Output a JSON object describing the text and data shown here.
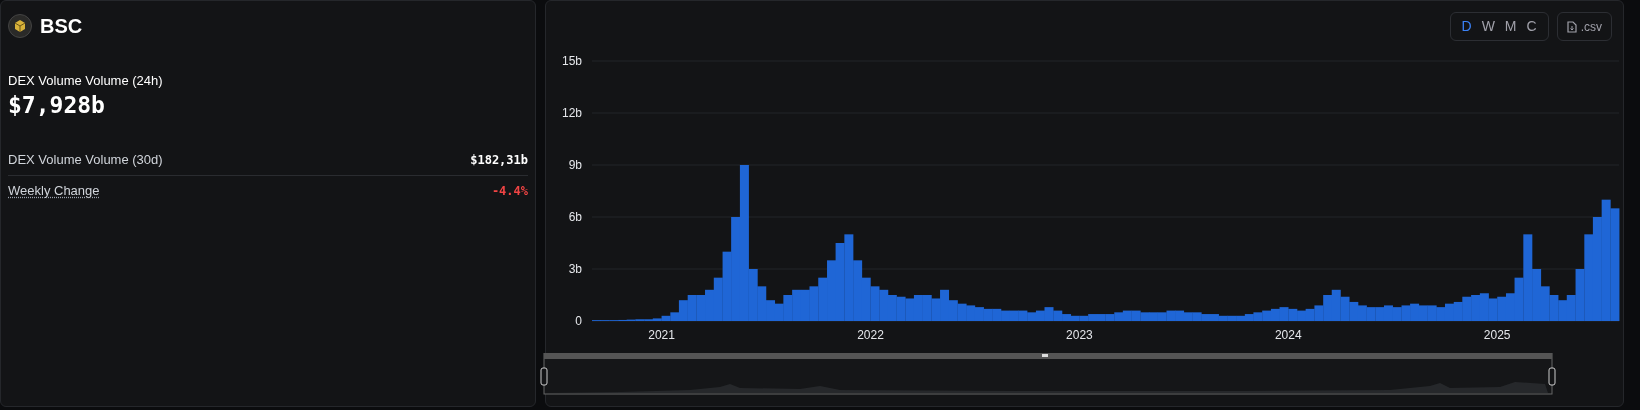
{
  "summary": {
    "chain": "BSC",
    "main_label": "DEX Volume Volume (24h)",
    "main_value": "$7,928b",
    "stats": [
      {
        "label": "DEX Volume Volume (30d)",
        "value": "$182,31b",
        "kind": "plain"
      },
      {
        "label": "Weekly Change",
        "value": "-4.4%",
        "kind": "change"
      }
    ]
  },
  "chart_panel": {
    "periods": [
      {
        "label": "D",
        "selected": true
      },
      {
        "label": "W",
        "selected": false
      },
      {
        "label": "M",
        "selected": false
      },
      {
        "label": "C",
        "selected": false
      }
    ],
    "csv_button": ".csv",
    "range_slider": {
      "level": 1
    },
    "chart_data": {
      "type": "bar",
      "grid": true,
      "ylim": [
        0,
        15
      ],
      "xlim": [
        2020.667,
        2025.583
      ],
      "yticks": [
        {
          "value": 0,
          "label": "0"
        },
        {
          "value": 3,
          "label": "3b"
        },
        {
          "value": 6,
          "label": "6b"
        },
        {
          "value": 9,
          "label": "9b"
        },
        {
          "value": 12,
          "label": "12b"
        },
        {
          "value": 15,
          "label": "15b"
        }
      ],
      "xticks": [
        {
          "value": 2021,
          "label": "2021"
        },
        {
          "value": 2022,
          "label": "2022"
        },
        {
          "value": 2023,
          "label": "2023"
        },
        {
          "value": 2024,
          "label": "2024"
        },
        {
          "value": 2025,
          "label": "2025"
        }
      ],
      "x": [
        2020.667,
        2020.708,
        2020.75,
        2020.792,
        2020.833,
        2020.875,
        2020.917,
        2020.958,
        2021,
        2021.042,
        2021.083,
        2021.125,
        2021.167,
        2021.208,
        2021.25,
        2021.292,
        2021.333,
        2021.375,
        2021.417,
        2021.458,
        2021.5,
        2021.542,
        2021.583,
        2021.625,
        2021.667,
        2021.708,
        2021.75,
        2021.792,
        2021.833,
        2021.875,
        2021.917,
        2021.958,
        2022,
        2022.042,
        2022.083,
        2022.125,
        2022.167,
        2022.208,
        2022.25,
        2022.292,
        2022.333,
        2022.375,
        2022.417,
        2022.458,
        2022.5,
        2022.542,
        2022.583,
        2022.625,
        2022.667,
        2022.708,
        2022.75,
        2022.792,
        2022.833,
        2022.875,
        2022.917,
        2022.958,
        2023,
        2023.042,
        2023.083,
        2023.125,
        2023.167,
        2023.208,
        2023.25,
        2023.292,
        2023.333,
        2023.375,
        2023.417,
        2023.458,
        2023.5,
        2023.542,
        2023.583,
        2023.625,
        2023.667,
        2023.708,
        2023.75,
        2023.792,
        2023.833,
        2023.875,
        2023.917,
        2023.958,
        2024,
        2024.042,
        2024.083,
        2024.125,
        2024.167,
        2024.208,
        2024.25,
        2024.292,
        2024.333,
        2024.375,
        2024.417,
        2024.458,
        2024.5,
        2024.542,
        2024.583,
        2024.625,
        2024.667,
        2024.708,
        2024.75,
        2024.792,
        2024.833,
        2024.875,
        2024.917,
        2024.958,
        2025,
        2025.042,
        2025.083,
        2025.125,
        2025.167,
        2025.208,
        2025.25,
        2025.292,
        2025.333,
        2025.375,
        2025.417,
        2025.458,
        2025.5,
        2025.542
      ],
      "series": [
        {
          "color": "#1f66d6",
          "values": [
            0.05,
            0.05,
            0.05,
            0.06,
            0.08,
            0.1,
            0.1,
            0.15,
            0.3,
            0.5,
            1.2,
            1.5,
            1.5,
            1.8,
            2.5,
            4,
            6,
            9,
            3,
            2,
            1.2,
            1,
            1.5,
            1.8,
            1.8,
            2,
            2.5,
            3.5,
            4.5,
            5,
            3.5,
            2.5,
            2,
            1.8,
            1.5,
            1.4,
            1.3,
            1.5,
            1.5,
            1.3,
            1.8,
            1.2,
            1,
            0.9,
            0.8,
            0.7,
            0.7,
            0.6,
            0.6,
            0.6,
            0.5,
            0.6,
            0.8,
            0.6,
            0.4,
            0.3,
            0.3,
            0.4,
            0.4,
            0.4,
            0.5,
            0.6,
            0.6,
            0.5,
            0.5,
            0.5,
            0.6,
            0.6,
            0.5,
            0.5,
            0.4,
            0.4,
            0.3,
            0.3,
            0.3,
            0.4,
            0.5,
            0.6,
            0.7,
            0.8,
            0.7,
            0.6,
            0.7,
            0.9,
            1.5,
            1.8,
            1.4,
            1.1,
            0.9,
            0.8,
            0.8,
            0.9,
            0.8,
            0.9,
            1,
            0.9,
            0.9,
            0.8,
            1,
            1.1,
            1.4,
            1.5,
            1.6,
            1.3,
            1.4,
            1.6,
            2.5,
            5,
            3,
            2,
            1.5,
            1.2,
            1.5,
            3,
            5,
            6,
            7,
            6.5
          ]
        }
      ]
    }
  }
}
